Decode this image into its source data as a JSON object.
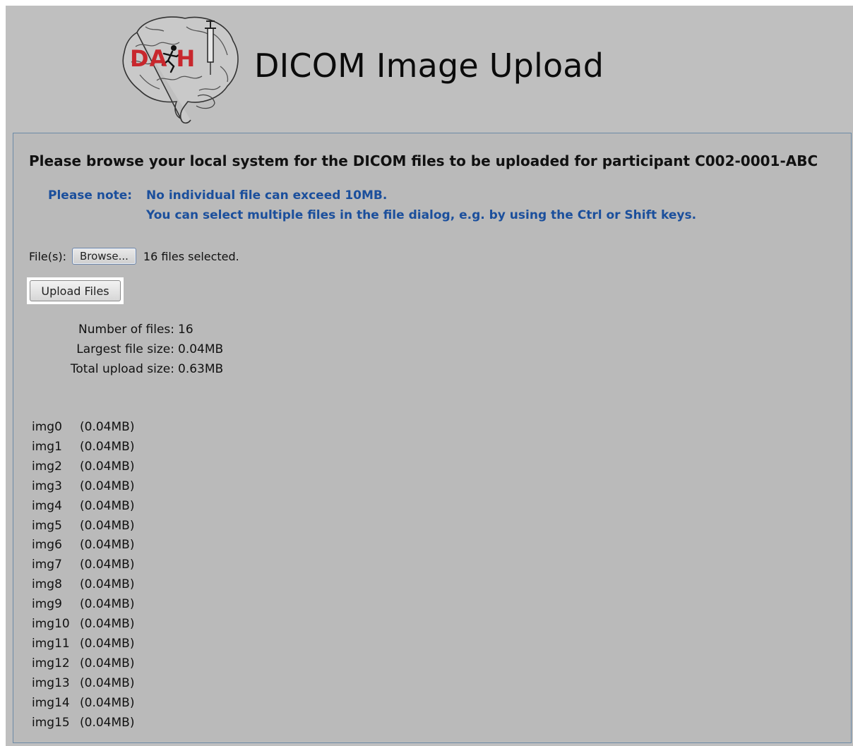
{
  "header": {
    "logo_text": "DA H",
    "title": "DICOM Image Upload"
  },
  "form": {
    "instructions": "Please browse your local system for the DICOM files to be uploaded for participant C002-0001-ABC",
    "note_label": "Please note:",
    "note_lines": [
      "No individual file can exceed 10MB.",
      "You can select multiple files in the file dialog, e.g. by using the Ctrl or Shift keys."
    ],
    "files_label": "File(s):",
    "browse_label": "Browse...",
    "files_selected_text": "16 files selected.",
    "upload_label": "Upload Files"
  },
  "stats": [
    {
      "label": "Number of files:",
      "value": "16"
    },
    {
      "label": "Largest file size:",
      "value": "0.04MB"
    },
    {
      "label": "Total upload size:",
      "value": "0.63MB"
    }
  ],
  "files": [
    {
      "name": "img0",
      "size": "(0.04MB)"
    },
    {
      "name": "img1",
      "size": "(0.04MB)"
    },
    {
      "name": "img2",
      "size": "(0.04MB)"
    },
    {
      "name": "img3",
      "size": "(0.04MB)"
    },
    {
      "name": "img4",
      "size": "(0.04MB)"
    },
    {
      "name": "img5",
      "size": "(0.04MB)"
    },
    {
      "name": "img6",
      "size": "(0.04MB)"
    },
    {
      "name": "img7",
      "size": "(0.04MB)"
    },
    {
      "name": "img8",
      "size": "(0.04MB)"
    },
    {
      "name": "img9",
      "size": "(0.04MB)"
    },
    {
      "name": "img10",
      "size": "(0.04MB)"
    },
    {
      "name": "img11",
      "size": "(0.04MB)"
    },
    {
      "name": "img12",
      "size": "(0.04MB)"
    },
    {
      "name": "img13",
      "size": "(0.04MB)"
    },
    {
      "name": "img14",
      "size": "(0.04MB)"
    },
    {
      "name": "img15",
      "size": "(0.04MB)"
    }
  ],
  "colors": {
    "page_bg": "#bfbfbf",
    "note_text": "#1b4f9c",
    "logo_red": "#c8272d",
    "panel_border": "#6c8aa6"
  }
}
